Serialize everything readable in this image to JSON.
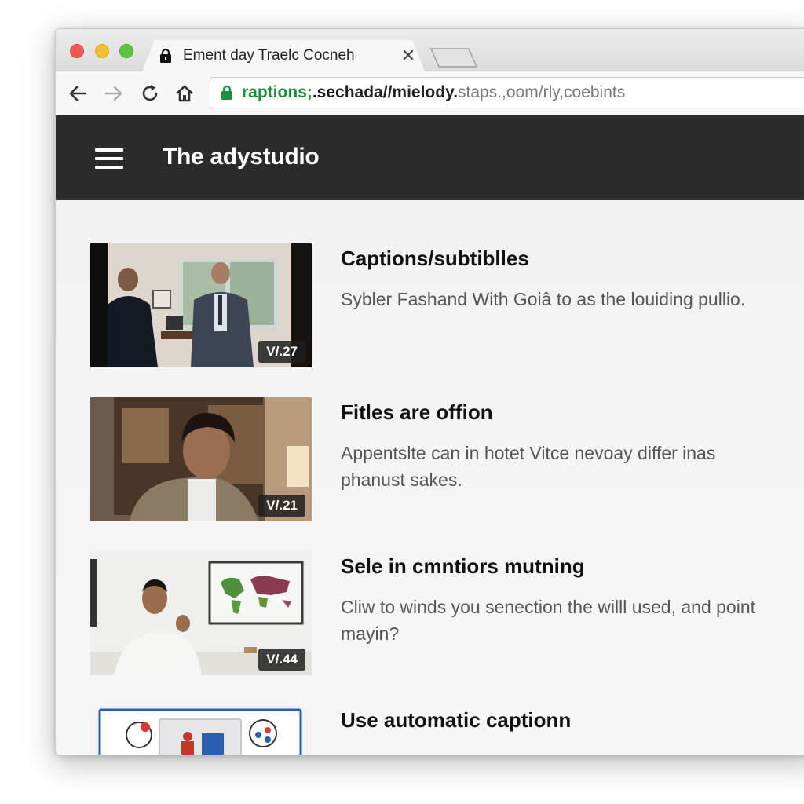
{
  "browser": {
    "tab_title": "Ement day Traelc Cocneh",
    "tab_close_glyph": "✕",
    "url_secure_part": "raptions;",
    "url_host_part": ".sechada//mielody.",
    "url_rest_part": "staps.,oom/rly,coebints"
  },
  "site": {
    "title": "The adystudio"
  },
  "videos": [
    {
      "title": "Captions/subtiblles",
      "description": "Sybler Fashand With Goiâ to as the louiding pullio.",
      "duration": "V/.27"
    },
    {
      "title": "Fitles are offion",
      "description": "Appentslte can in hotet Vitce nevoay differ inas phanust sakes.",
      "duration": "V/.21"
    },
    {
      "title": "Sele in cmntiors mutning",
      "description": "Cliw to winds you senection the willl used, and point mayin?",
      "duration": "V/.44"
    },
    {
      "title": "Use automatic captionn",
      "description": "",
      "duration": ""
    }
  ],
  "colors": {
    "header_bg": "#2b2b2b",
    "secure_green": "#1e8f3c",
    "close_red": "#ee5a52",
    "minimize_yellow": "#f5bd31",
    "maximize_green": "#5fc43f"
  },
  "icons": [
    "close-dot",
    "minimize-dot",
    "maximize-dot",
    "lock-icon",
    "back-arrow-icon",
    "forward-arrow-icon",
    "reload-icon",
    "home-icon",
    "hamburger-menu-icon"
  ]
}
